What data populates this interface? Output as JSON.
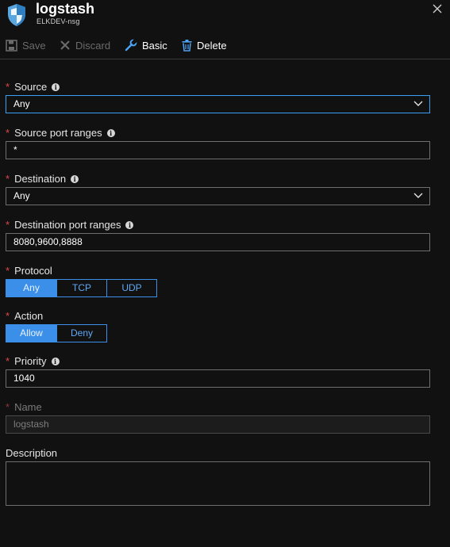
{
  "header": {
    "title": "logstash",
    "subtitle": "ELKDEV-nsg"
  },
  "toolbar": {
    "save_label": "Save",
    "discard_label": "Discard",
    "basic_label": "Basic",
    "delete_label": "Delete"
  },
  "form": {
    "required_marker": "*",
    "source": {
      "label": "Source",
      "value": "Any"
    },
    "source_port_ranges": {
      "label": "Source port ranges",
      "value": "*"
    },
    "destination": {
      "label": "Destination",
      "value": "Any"
    },
    "destination_port_ranges": {
      "label": "Destination port ranges",
      "value": "8080,9600,8888"
    },
    "protocol": {
      "label": "Protocol",
      "options": [
        "Any",
        "TCP",
        "UDP"
      ],
      "selected": "Any"
    },
    "action": {
      "label": "Action",
      "options": [
        "Allow",
        "Deny"
      ],
      "selected": "Allow"
    },
    "priority": {
      "label": "Priority",
      "value": "1040"
    },
    "name": {
      "label": "Name",
      "value": "logstash"
    },
    "description": {
      "label": "Description",
      "value": ""
    }
  },
  "icons": {
    "info": "i",
    "header": "shield-icon",
    "close": "close-icon",
    "save": "save-icon",
    "discard": "discard-x-icon",
    "basic": "wrench-icon",
    "delete": "trash-icon"
  },
  "colors": {
    "accent": "#3b8fe8",
    "required": "#e0474c",
    "background": "#111112"
  }
}
